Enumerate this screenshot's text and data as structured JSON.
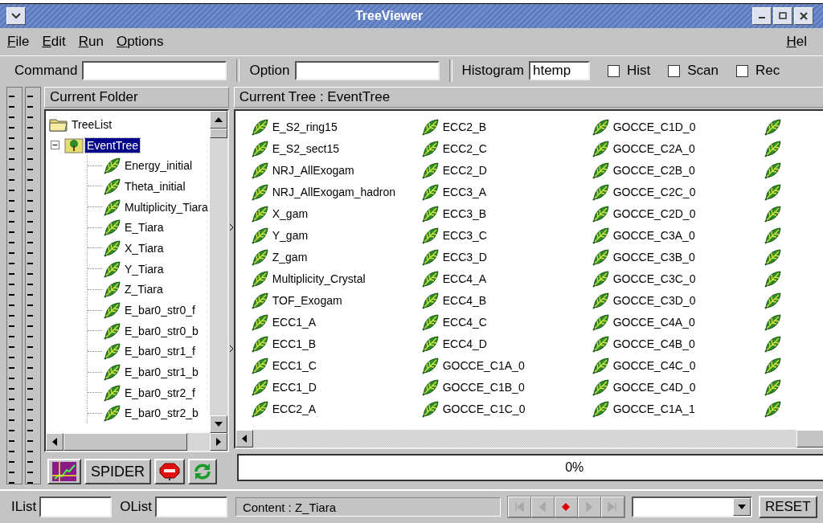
{
  "window": {
    "title": "TreeViewer"
  },
  "menu": [
    {
      "label": "File"
    },
    {
      "label": "Edit"
    },
    {
      "label": "Run"
    },
    {
      "label": "Options"
    }
  ],
  "help_menu": {
    "label": "Hel"
  },
  "toolbar": {
    "fields": [
      {
        "label": "Command"
      },
      {
        "label": "Option"
      },
      {
        "label": "Histogram",
        "value": "htemp"
      }
    ],
    "checkboxes": [
      {
        "label": "Hist",
        "checked": false
      },
      {
        "label": "Scan",
        "checked": false
      },
      {
        "label": "Rec",
        "checked": false
      }
    ]
  },
  "folder_panel": {
    "title": "Current Folder",
    "tree": [
      {
        "label": "TreeList",
        "kind": "folder",
        "selected": false,
        "children": [
          {
            "label": "EventTree",
            "kind": "tree",
            "expanded": true,
            "selected": true,
            "children": [
              {
                "label": "Energy_initial",
                "kind": "leaf",
                "selected": false
              },
              {
                "label": "Theta_initial",
                "kind": "leaf",
                "selected": false
              },
              {
                "label": "Multiplicity_Tiara",
                "kind": "leaf",
                "selected": false
              },
              {
                "label": "E_Tiara",
                "kind": "leaf",
                "selected": false
              },
              {
                "label": "X_Tiara",
                "kind": "leaf",
                "selected": false
              },
              {
                "label": "Y_Tiara",
                "kind": "leaf",
                "selected": false
              },
              {
                "label": "Z_Tiara",
                "kind": "leaf",
                "selected": false
              },
              {
                "label": "E_bar0_str0_f",
                "kind": "leaf",
                "selected": false
              },
              {
                "label": "E_bar0_str0_b",
                "kind": "leaf",
                "selected": false
              },
              {
                "label": "E_bar0_str1_f",
                "kind": "leaf",
                "selected": false
              },
              {
                "label": "E_bar0_str1_b",
                "kind": "leaf",
                "selected": false
              },
              {
                "label": "E_bar0_str2_f",
                "kind": "leaf",
                "selected": false
              },
              {
                "label": "E_bar0_str2_b",
                "kind": "leaf",
                "selected": false
              }
            ]
          }
        ]
      }
    ],
    "buttons": [
      {
        "kind": "graph"
      },
      {
        "kind": "text",
        "label": "SPIDER"
      },
      {
        "kind": "stop"
      },
      {
        "kind": "refresh"
      }
    ]
  },
  "tree_panel": {
    "title": "Current Tree : EventTree",
    "columns": [
      [
        "E_S2_ring15",
        "E_S2_sect15",
        "NRJ_AllExogam",
        "NRJ_AllExogam_hadron",
        "X_gam",
        "Y_gam",
        "Z_gam",
        "Multiplicity_Crystal",
        "TOF_Exogam",
        "ECC1_A",
        "ECC1_B",
        "ECC1_C",
        "ECC1_D",
        "ECC2_A"
      ],
      [
        "ECC2_B",
        "ECC2_C",
        "ECC2_D",
        "ECC3_A",
        "ECC3_B",
        "ECC3_C",
        "ECC3_D",
        "ECC4_A",
        "ECC4_B",
        "ECC4_C",
        "ECC4_D",
        "GOCCE_C1A_0",
        "GOCCE_C1B_0",
        "GOCCE_C1C_0"
      ],
      [
        "GOCCE_C1D_0",
        "GOCCE_C2A_0",
        "GOCCE_C2B_0",
        "GOCCE_C2C_0",
        "GOCCE_C2D_0",
        "GOCCE_C3A_0",
        "GOCCE_C3B_0",
        "GOCCE_C3C_0",
        "GOCCE_C3D_0",
        "GOCCE_C4A_0",
        "GOCCE_C4B_0",
        "GOCCE_C4C_0",
        "GOCCE_C4D_0",
        "GOCCE_C1A_1"
      ]
    ],
    "progress": {
      "level": 0,
      "reading": "0%"
    }
  },
  "status_bar": {
    "fields": [
      {
        "label": "IList"
      },
      {
        "label": "OList"
      }
    ],
    "content": "Content : Z_Tiara",
    "nav_buttons": [
      {
        "kind": "first",
        "disabled": true
      },
      {
        "kind": "previous",
        "disabled": true
      },
      {
        "kind": "record",
        "disabled": false
      },
      {
        "kind": "next",
        "disabled": true
      },
      {
        "kind": "last",
        "disabled": true
      }
    ],
    "reset": "RESET"
  }
}
